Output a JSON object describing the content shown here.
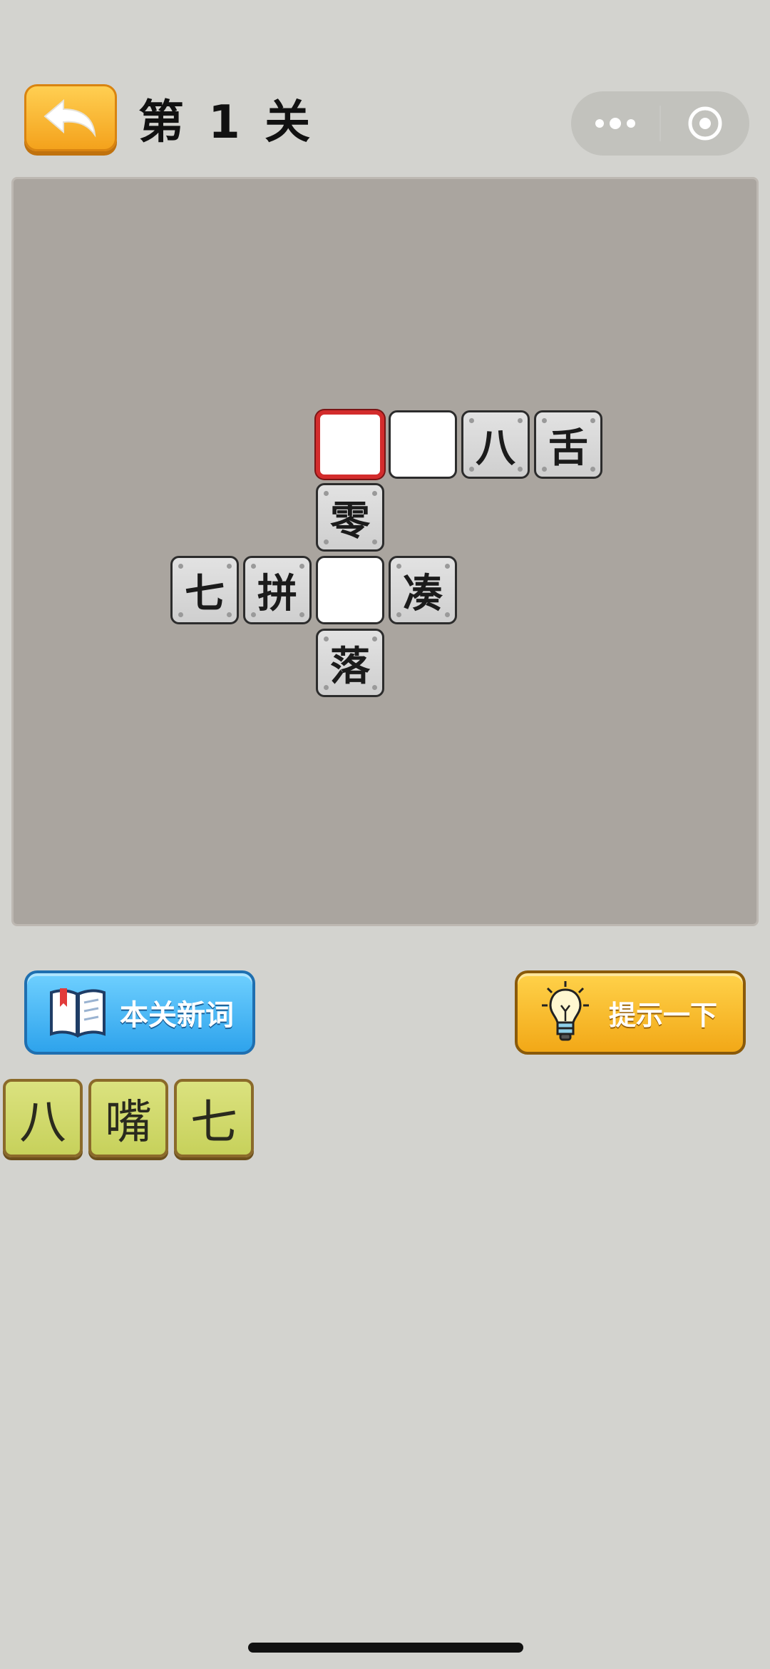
{
  "header": {
    "title": "第 1 关",
    "back_icon": "undo-arrow-icon",
    "menu_icon": "more-dots-icon",
    "close_icon": "target-circle-icon"
  },
  "board": {
    "row1": [
      "",
      "",
      "八",
      "舌"
    ],
    "col_mid": [
      "零"
    ],
    "row3": [
      "七",
      "拼",
      "",
      "凑"
    ],
    "col_bottom": [
      "落"
    ]
  },
  "buttons": {
    "words_label": "本关新词",
    "hint_label": "提示一下"
  },
  "tiles": [
    "八",
    "嘴",
    "七"
  ],
  "colors": {
    "background": "#d3d3cf",
    "board": "#aaa59f",
    "selected_border": "#d32c2c",
    "tile_fill": "#c7d15b",
    "hint_button": "#f2a817",
    "words_button": "#2ea3ec"
  }
}
